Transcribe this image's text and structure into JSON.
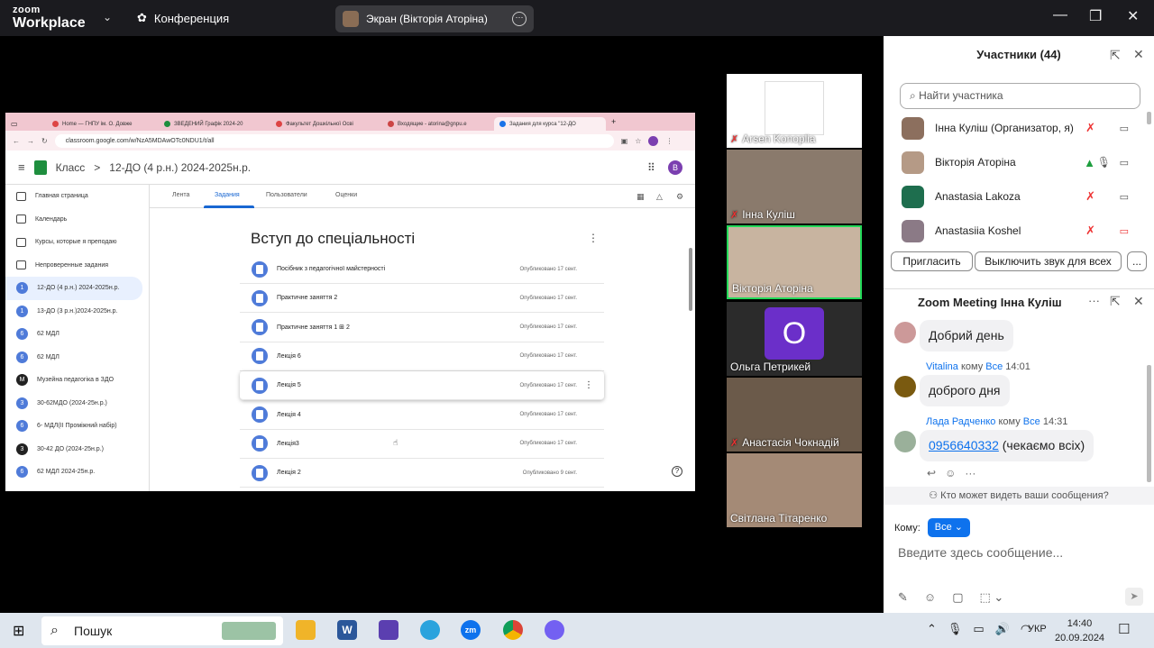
{
  "zoom": {
    "logo_top": "zoom",
    "logo_bottom": "Workplace",
    "conference_label": "Конференция",
    "screen_share_label": "Экран (Вікторія Аторіна)"
  },
  "browser": {
    "tabs": [
      "Home — ГНПУ ім. О. Довже",
      "ЗВЕДЕНИЙ Графік 2024-20",
      "Факультет Дошкільної Осві",
      "Входящие - atorina@gnpu.e",
      "Задания для курса \"12-ДО"
    ],
    "new_tab": "+",
    "url": "classroom.google.com/w/NzA5MDAwOTc0NDU1/t/all"
  },
  "classroom": {
    "brand": "Класс",
    "breadcrumb_sep": ">",
    "course": "12-ДО (4 р.н.) 2024-2025н.р.",
    "avatar_letter": "В",
    "sidebar": [
      {
        "label": "Главная страница",
        "badge": ""
      },
      {
        "label": "Календарь",
        "badge": ""
      },
      {
        "label": "Курсы, которые я преподаю",
        "badge": ""
      },
      {
        "label": "Непроверенные задания",
        "badge": ""
      },
      {
        "label": "12-ДО (4 р.н.) 2024-2025н.р.",
        "badge": "1",
        "color": "#4f7bd9"
      },
      {
        "label": "13-ДО (3 р.н.)2024-2025н.р.",
        "badge": "1",
        "color": "#4f7bd9"
      },
      {
        "label": "62 МДЛ",
        "badge": "6",
        "color": "#4f7bd9"
      },
      {
        "label": "62 МДЛ",
        "badge": "6",
        "color": "#4f7bd9"
      },
      {
        "label": "Музейна педагогіка в ЗДО",
        "badge": "М",
        "color": "#222"
      },
      {
        "label": "30-62МДО (2024-25н.р.)",
        "badge": "3",
        "color": "#4f7bd9"
      },
      {
        "label": "6- МДЛ(ІІ Проміжний набір)",
        "badge": "6",
        "color": "#4f7bd9"
      },
      {
        "label": "30-42 ДО (2024-25н.р.)",
        "badge": "3",
        "color": "#222"
      },
      {
        "label": "62 МДЛ 2024-25н.р.",
        "badge": "6",
        "color": "#4f7bd9"
      }
    ],
    "tabs": [
      "Лента",
      "Задания",
      "Пользователи",
      "Оценки"
    ],
    "topic_title": "Вступ до спеціальності",
    "assignments": [
      {
        "title": "Посібник з педагогічної майстерності",
        "published": "Опубликовано 17 сент."
      },
      {
        "title": "Практичне заняття 2",
        "published": "Опубликовано 17 сент."
      },
      {
        "title": "Практичне заняття 1  ⊞ 2",
        "published": "Опубликовано 17 сент."
      },
      {
        "title": "Лекція 6",
        "published": "Опубликовано 17 сент."
      },
      {
        "title": "Лекція 5",
        "published": "Опубликовано 17 сент."
      },
      {
        "title": "Лекція 4",
        "published": "Опубликовано 17 сент."
      },
      {
        "title": "Лекція3",
        "published": "Опубликовано 17 сент."
      },
      {
        "title": "Лекція 2",
        "published": "Опубликовано 9 сент."
      }
    ]
  },
  "videos": [
    {
      "name": "Arsen Konoplia",
      "color": "#ffffff"
    },
    {
      "name": "Інна Куліш",
      "color": "#8a7a6c"
    },
    {
      "name": "Вікторія Аторіна",
      "color": "#c8b4a0"
    },
    {
      "name": "Ольга Петрикей",
      "color": "#2b2b2b",
      "initial": "O"
    },
    {
      "name": "Анастасія Чокнадій",
      "color": "#6b5a4a"
    },
    {
      "name": "Світлана Тітаренко",
      "color": "#a48a76"
    }
  ],
  "participants": {
    "title": "Участники (44)",
    "search_placeholder": "Найти участника",
    "list": [
      {
        "name": "Інна Куліш (Организатор, я)",
        "color": "#8c6f5e"
      },
      {
        "name": "Вікторія Аторіна",
        "color": "#b59a86"
      },
      {
        "name": "Anastasia Lakoza",
        "color": "#1e6e4e"
      },
      {
        "name": "Anastasiia Koshel",
        "color": "#8b7a86"
      }
    ],
    "invite_btn": "Пригласить",
    "mute_all_btn": "Выключить звук для всех",
    "more_btn": "..."
  },
  "chat": {
    "title": "Zoom Meeting Інна Куліш",
    "messages": [
      {
        "text": "Добрий день"
      },
      {
        "sender": "Vitalina",
        "to_word": "кому",
        "to": "Все",
        "time": "14:01",
        "text": "доброго дня"
      },
      {
        "sender": "Лада Радченко",
        "to_word": "кому",
        "to": "Все",
        "time": "14:31",
        "phone": "0956640332",
        "text": " (чекаємо всіх)"
      }
    ],
    "who_can_see": "Кто может видеть ваши сообщения?",
    "to_label": "Кому:",
    "to_value": "Все",
    "input_placeholder": "Введите здесь сообщение..."
  },
  "taskbar": {
    "search_label": "Пошук",
    "lang": "УКР",
    "time": "14:40",
    "date": "20.09.2024"
  }
}
